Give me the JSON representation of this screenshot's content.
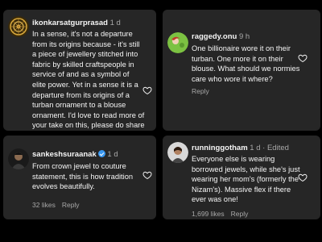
{
  "comments": [
    {
      "username": "ikonkarsatgurprasad",
      "time": "1 d",
      "text": "In a sense, it's not a departure from its origins because - it's still a piece of jewellery stitched into fabric by skilled craftspeople in service of and as a symbol of elite power. Yet in a sense it is a departure from its origins of a turban ornament to a blouse ornament. I'd love to read more of your take on this, please do share the link!",
      "avatar_icon": "mandala-avatar-icon"
    },
    {
      "username": "raggedy.onu",
      "time": "9 h",
      "text": "One billionaire wore it on their turban. One more it on their blouse. What should we normies care who wore it where?",
      "reply_label": "Reply",
      "avatar_icon": "green-avatar-icon"
    },
    {
      "username": "sankeshsuraanak",
      "time": "1 d",
      "text": "From crown jewel to couture statement, this is how tradition evolves beautifully.",
      "likes": "32 likes",
      "reply_label": "Reply",
      "avatar_icon": "portrait-avatar-icon"
    },
    {
      "username": "runninggotham",
      "time": "1 d",
      "edited": "· Edited",
      "text": "Everyone else is wearing borrowed jewels, while she's just wearing her mom's (formerly the Nizam's). Massive flex if there ever was one!",
      "likes": "1,699 likes",
      "reply_label": "Reply",
      "avatar_icon": "photo-avatar-icon"
    }
  ],
  "colors": {
    "card_bg": "#262626",
    "text": "#f5f5f5",
    "secondary": "#a8a8a8",
    "verified": "#3897f0"
  }
}
